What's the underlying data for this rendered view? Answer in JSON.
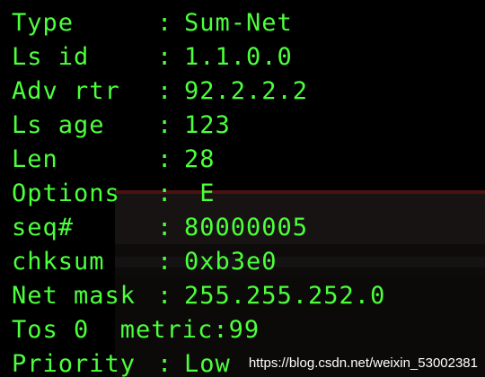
{
  "colors": {
    "background": "#000000",
    "text": "#4cff3c",
    "watermark": "#ffffff"
  },
  "lsa": [
    {
      "key": "Type",
      "sep": ":",
      "value": "Sum-Net"
    },
    {
      "key": "Ls id",
      "sep": ":",
      "value": "1.1.0.0"
    },
    {
      "key": "Adv rtr",
      "sep": ":",
      "value": "92.2.2.2"
    },
    {
      "key": "Ls age",
      "sep": ":",
      "value": "123"
    },
    {
      "key": "Len",
      "sep": ":",
      "value": "28"
    },
    {
      "key": "Options",
      "sep": ":",
      "value": " E"
    },
    {
      "key": "seq#",
      "sep": ":",
      "value": "80000005"
    },
    {
      "key": "chksum",
      "sep": ":",
      "value": "0xb3e0"
    },
    {
      "key": "Net mask",
      "sep": ":",
      "value": "255.255.252.0"
    },
    {
      "key": "Tos 0  metric",
      "sep": ":",
      "value": "99"
    },
    {
      "key": "Priority",
      "sep": ":",
      "value": "Low"
    }
  ],
  "watermark": "https://blog.csdn.net/weixin_53002381"
}
